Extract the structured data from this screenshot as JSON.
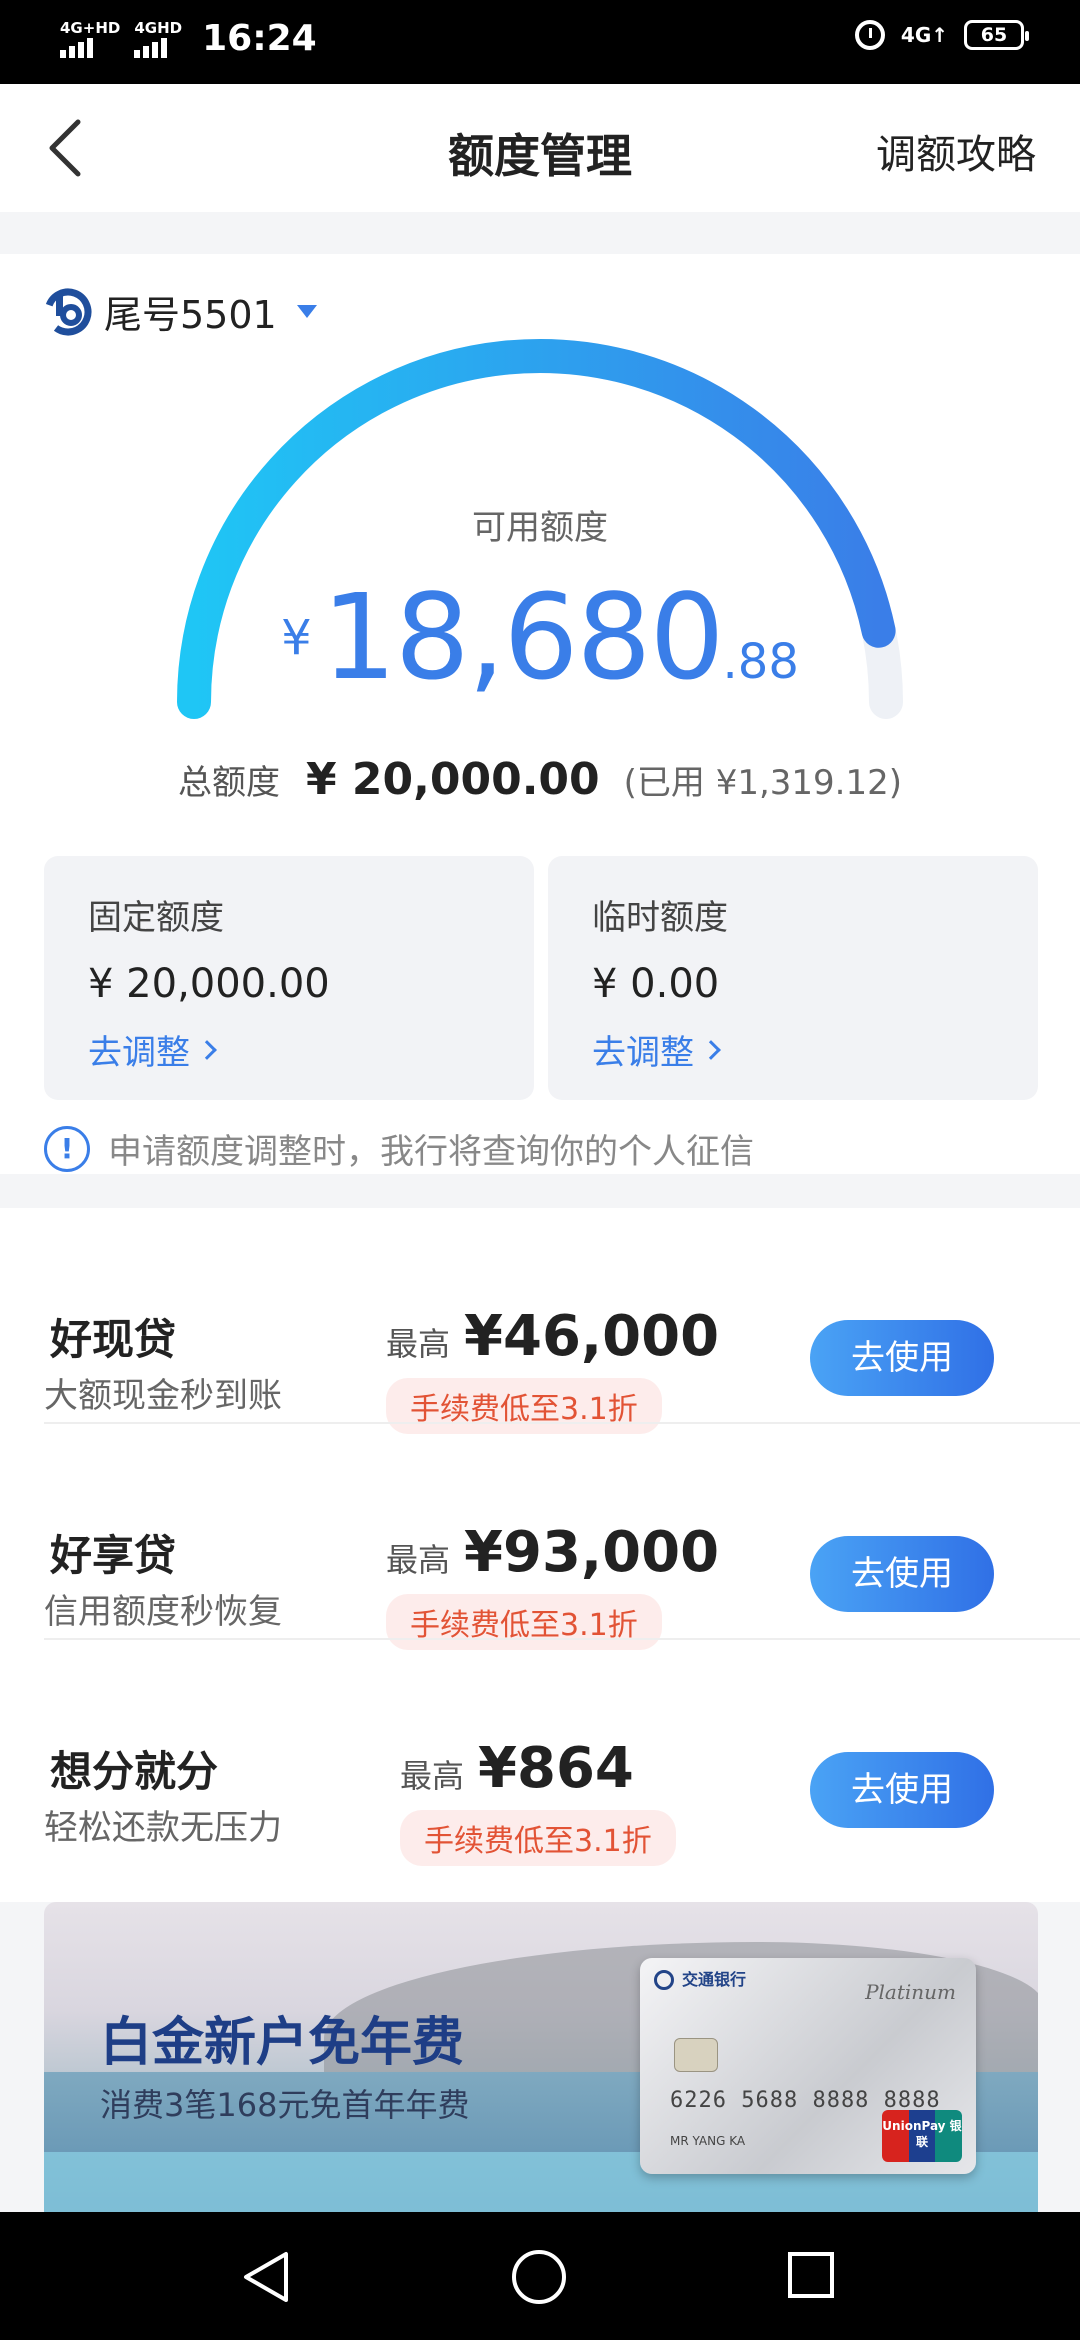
{
  "status": {
    "signal1": "4G+HD",
    "signal2": "4GHD",
    "time": "16:24",
    "network": "4G↑",
    "battery": "65"
  },
  "nav": {
    "title": "额度管理",
    "right_link": "调额攻略"
  },
  "account": {
    "label": "尾号5501"
  },
  "available": {
    "label": "可用额度",
    "currency": "¥",
    "integer": "18,680",
    "decimal": ".88",
    "gauge_fraction": 0.934
  },
  "total": {
    "label": "总额度",
    "amount": "¥ 20,000.00",
    "used": "(已用 ¥1,319.12)"
  },
  "fixed": {
    "title": "固定额度",
    "amount": "¥ 20,000.00",
    "link": "去调整"
  },
  "temporary": {
    "title": "临时额度",
    "amount": "¥ 0.00",
    "link": "去调整"
  },
  "notice": {
    "icon": "!",
    "text": "申请额度调整时，我行将查询你的个人征信"
  },
  "loans": [
    {
      "name": "好现贷",
      "subtitle": "大额现金秒到账",
      "max_label": "最高",
      "max_amount": "¥46,000",
      "fee": "手续费低至3.1折",
      "button": "去使用"
    },
    {
      "name": "好享贷",
      "subtitle": "信用额度秒恢复",
      "max_label": "最高",
      "max_amount": "¥93,000",
      "fee": "手续费低至3.1折",
      "button": "去使用"
    },
    {
      "name": "想分就分",
      "subtitle": "轻松还款无压力",
      "max_label": "最高",
      "max_amount": "¥864",
      "fee": "手续费低至3.1折",
      "button": "去使用"
    }
  ],
  "banner": {
    "title": "白金新户免年费",
    "subtitle": "消费3笔168元免首年年费",
    "card_bank": "交通银行",
    "card_tier": "Platinum",
    "card_number": "6226 5688 8888 8888",
    "card_holder": "MR YANG KA",
    "card_network": "UnionPay 银联"
  },
  "colors": {
    "accent": "#3a7ee8",
    "gauge_start": "#1fc6f5",
    "gauge_end": "#3a7ee8",
    "fee_text": "#e25335",
    "fee_bg": "#fdeceb"
  }
}
